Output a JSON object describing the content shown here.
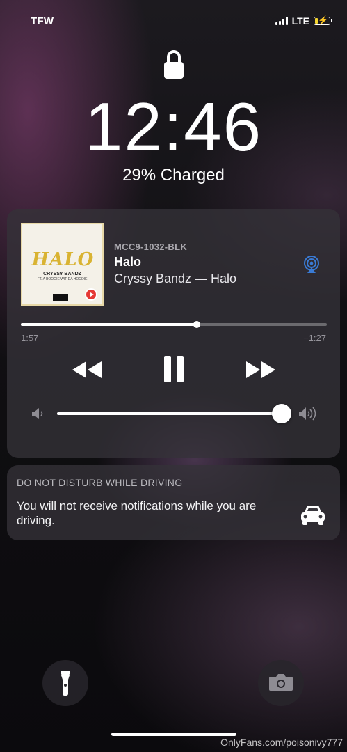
{
  "status_bar": {
    "carrier": "TFW",
    "network": "LTE",
    "signal_bars": 4,
    "battery_level": 0.29,
    "battery_charging": true,
    "battery_color": "#f5d530"
  },
  "lock_screen": {
    "lock_icon": "lock-icon",
    "time": "12:46",
    "charge_status": "29% Charged"
  },
  "now_playing": {
    "album_art": {
      "title": "HALO",
      "artist": "CRYSSY BANDZ",
      "feature": "FT. A BOOGIE WIT DA HOODIE"
    },
    "device": "MCC9-1032-BLK",
    "title": "Halo",
    "subtitle": "Cryssy Bandz — Halo",
    "elapsed": "1:57",
    "remaining": "−1:27",
    "progress": 0.575,
    "volume": 0.98,
    "airplay_color": "#3a7bd5",
    "icons": {
      "airplay": "airplay-icon",
      "rewind": "rewind-icon",
      "pause": "pause-icon",
      "fast_forward": "fast-forward-icon",
      "volume_low": "volume-low-icon",
      "volume_high": "volume-high-icon"
    }
  },
  "notification": {
    "header": "DO NOT DISTURB WHILE DRIVING",
    "body": "You will not receive notifications while you are driving.",
    "icon": "car-icon"
  },
  "bottom": {
    "left_button": "flashlight-icon",
    "right_button": "camera-icon"
  },
  "watermark": "OnlyFans.com/poisonivy777"
}
